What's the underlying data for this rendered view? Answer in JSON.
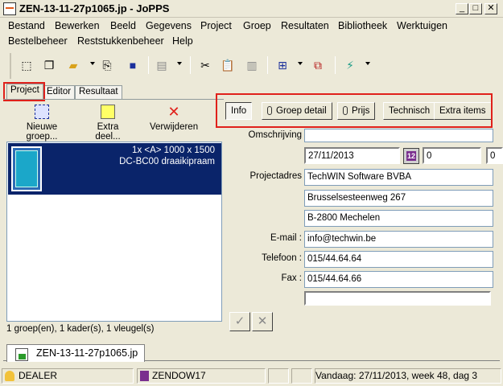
{
  "window": {
    "title": "ZEN-13-11-27p1065.jp - JoPPS",
    "controls": {
      "minimize": "_",
      "maximize": "□",
      "close": "✕"
    }
  },
  "menu_row1": [
    "Bestand",
    "Bewerken",
    "Beeld",
    "Gegevens",
    "Project",
    "Groep",
    "Resultaten",
    "Bibliotheek",
    "Werktuigen"
  ],
  "menu_row2": [
    "Bestelbeheer",
    "Reststukkenbeheer",
    "Help"
  ],
  "tabs": [
    "Project",
    "Editor",
    "Resultaat"
  ],
  "actions": {
    "new_group": "Nieuwe groep...",
    "extra_part": "Extra deel...",
    "delete": "Verwijderen"
  },
  "list": {
    "items": [
      {
        "line1": "1x <A> 1000 x 1500",
        "line2": "DC-BC00 draaikipraam"
      }
    ],
    "status": "1 groep(en), 1 kader(s), 1 vleugel(s)"
  },
  "info_tabs": [
    "Info",
    "Groep detail",
    "Prijs",
    "Technisch",
    "Extra items"
  ],
  "form": {
    "omschrijving_label": "Omschrijving",
    "omschrijving_value": "",
    "date_value": "27/11/2013",
    "number1": "0",
    "number2": "0",
    "projectadres_label": "Projectadres",
    "address": [
      "TechWIN Software BVBA",
      "Brusselsesteenweg 267",
      "B-2800 Mechelen"
    ],
    "email_label": "E-mail :",
    "email_value": "info@techwin.be",
    "phone_label": "Telefoon :",
    "phone_value": "015/44.64.64",
    "fax_label": "Fax :",
    "fax_value": "015/44.64.66",
    "extra_value": "",
    "confirm": "✓",
    "cancel": "✕"
  },
  "document_tab": {
    "name": "ZEN-13-11-27p1065.jp"
  },
  "statusbar": {
    "user": "DEALER",
    "product": "ZENDOW17",
    "today": "Vandaag: 27/11/2013, week 48, dag 3"
  },
  "colors": {
    "selection": "#0a246a",
    "highlight_box": "#e0211b",
    "window_bg": "#ece9d8"
  }
}
